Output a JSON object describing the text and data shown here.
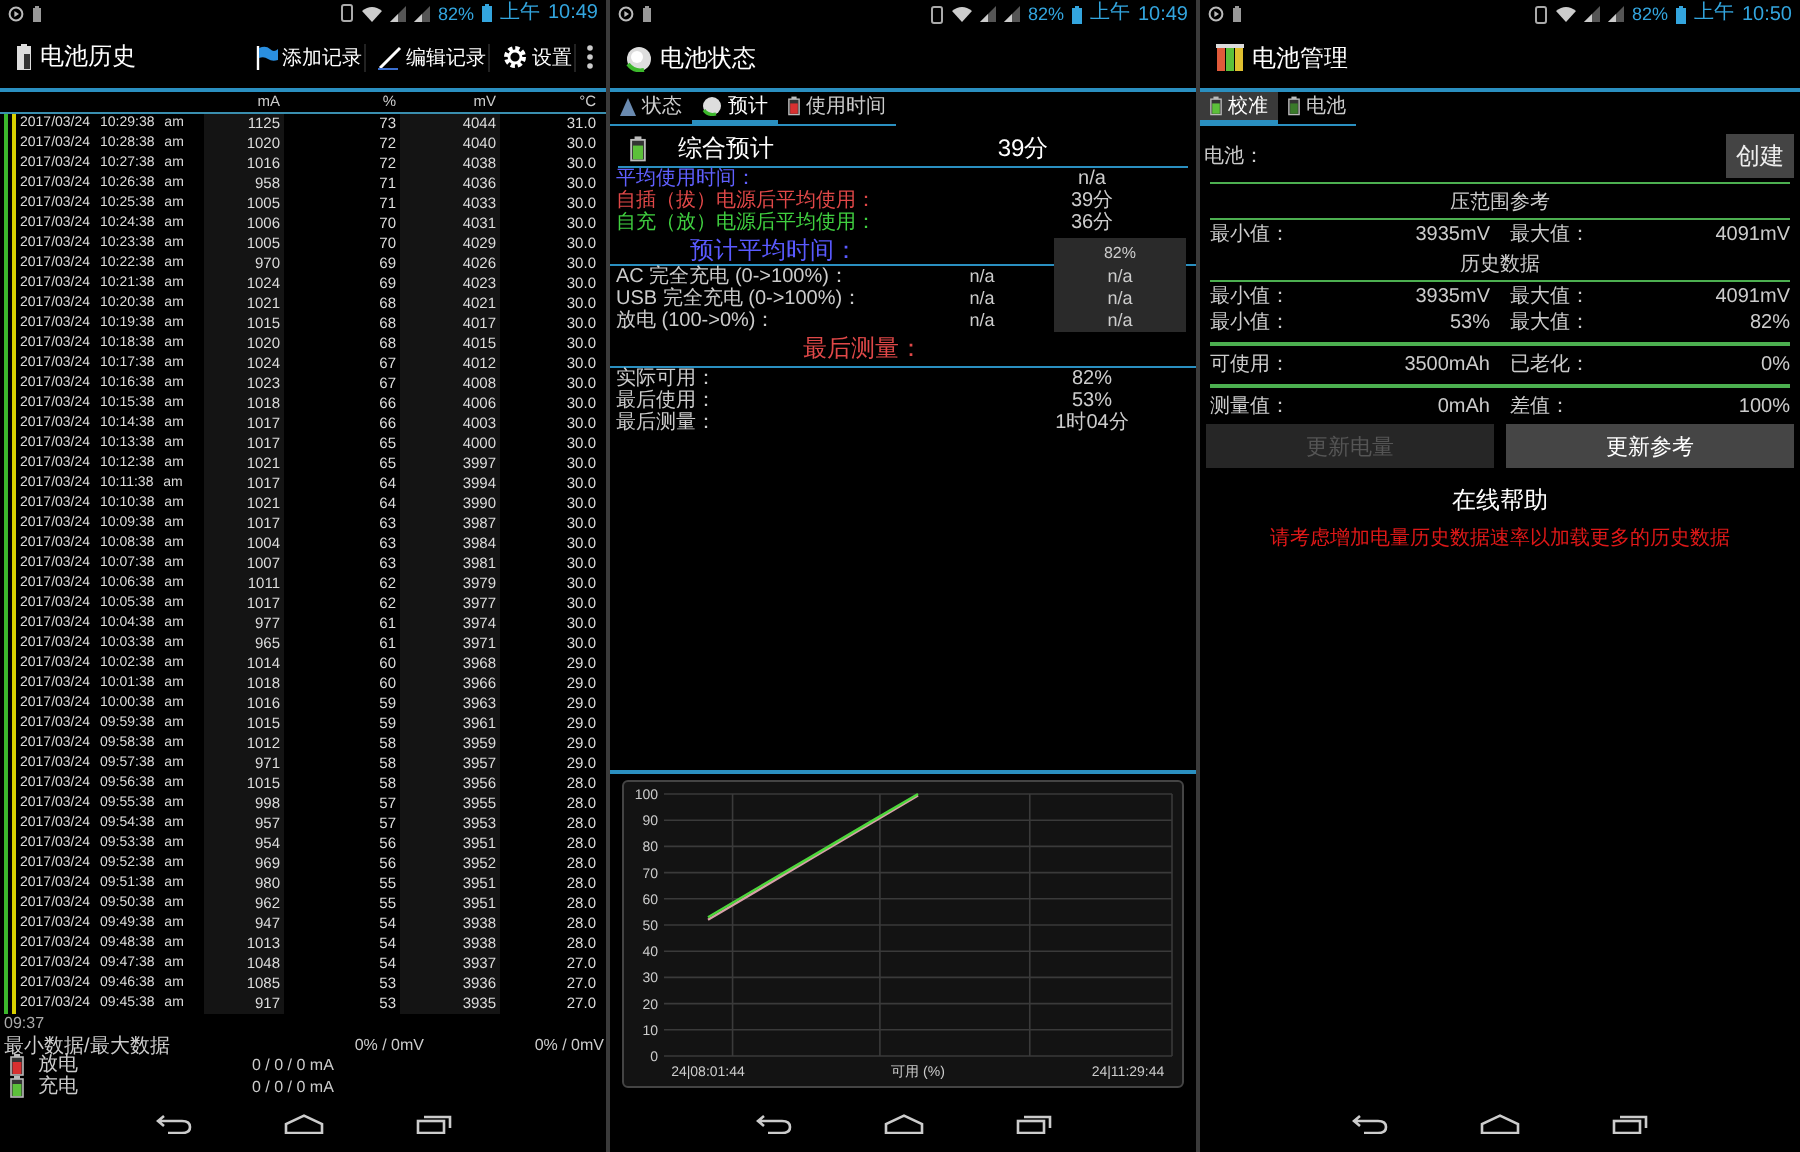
{
  "history_screen": {
    "status_bar": {
      "battery": "82%",
      "period": "上午",
      "time": "10:49"
    },
    "title": "电池历史",
    "actions": [
      {
        "label": "添加记录"
      },
      {
        "label": "编辑记录"
      },
      {
        "label": "设置"
      }
    ],
    "columns": [
      "",
      "mA",
      "%",
      "mV",
      "°C"
    ],
    "rows": [
      [
        "2017/03/24 10:29:38 am",
        "1125",
        "73",
        "4044",
        "31.0"
      ],
      [
        "2017/03/24 10:28:38 am",
        "1020",
        "72",
        "4040",
        "30.0"
      ],
      [
        "2017/03/24 10:27:38 am",
        "1016",
        "72",
        "4038",
        "30.0"
      ],
      [
        "2017/03/24 10:26:38 am",
        "958",
        "71",
        "4036",
        "30.0"
      ],
      [
        "2017/03/24 10:25:38 am",
        "1005",
        "71",
        "4033",
        "30.0"
      ],
      [
        "2017/03/24 10:24:38 am",
        "1006",
        "70",
        "4031",
        "30.0"
      ],
      [
        "2017/03/24 10:23:38 am",
        "1005",
        "70",
        "4029",
        "30.0"
      ],
      [
        "2017/03/24 10:22:38 am",
        "970",
        "69",
        "4026",
        "30.0"
      ],
      [
        "2017/03/24 10:21:38 am",
        "1024",
        "69",
        "4023",
        "30.0"
      ],
      [
        "2017/03/24 10:20:38 am",
        "1021",
        "68",
        "4021",
        "30.0"
      ],
      [
        "2017/03/24 10:19:38 am",
        "1015",
        "68",
        "4017",
        "30.0"
      ],
      [
        "2017/03/24 10:18:38 am",
        "1020",
        "68",
        "4015",
        "30.0"
      ],
      [
        "2017/03/24 10:17:38 am",
        "1024",
        "67",
        "4012",
        "30.0"
      ],
      [
        "2017/03/24 10:16:38 am",
        "1023",
        "67",
        "4008",
        "30.0"
      ],
      [
        "2017/03/24 10:15:38 am",
        "1018",
        "66",
        "4006",
        "30.0"
      ],
      [
        "2017/03/24 10:14:38 am",
        "1017",
        "66",
        "4003",
        "30.0"
      ],
      [
        "2017/03/24 10:13:38 am",
        "1017",
        "65",
        "4000",
        "30.0"
      ],
      [
        "2017/03/24 10:12:38 am",
        "1021",
        "65",
        "3997",
        "30.0"
      ],
      [
        "2017/03/24 10:11:38 am",
        "1017",
        "64",
        "3994",
        "30.0"
      ],
      [
        "2017/03/24 10:10:38 am",
        "1021",
        "64",
        "3990",
        "30.0"
      ],
      [
        "2017/03/24 10:09:38 am",
        "1017",
        "63",
        "3987",
        "30.0"
      ],
      [
        "2017/03/24 10:08:38 am",
        "1004",
        "63",
        "3984",
        "30.0"
      ],
      [
        "2017/03/24 10:07:38 am",
        "1007",
        "63",
        "3981",
        "30.0"
      ],
      [
        "2017/03/24 10:06:38 am",
        "1011",
        "62",
        "3979",
        "30.0"
      ],
      [
        "2017/03/24 10:05:38 am",
        "1017",
        "62",
        "3977",
        "30.0"
      ],
      [
        "2017/03/24 10:04:38 am",
        "977",
        "61",
        "3974",
        "30.0"
      ],
      [
        "2017/03/24 10:03:38 am",
        "965",
        "61",
        "3971",
        "30.0"
      ],
      [
        "2017/03/24 10:02:38 am",
        "1014",
        "60",
        "3968",
        "29.0"
      ],
      [
        "2017/03/24 10:01:38 am",
        "1018",
        "60",
        "3966",
        "29.0"
      ],
      [
        "2017/03/24 10:00:38 am",
        "1016",
        "59",
        "3963",
        "29.0"
      ],
      [
        "2017/03/24 09:59:38 am",
        "1015",
        "59",
        "3961",
        "29.0"
      ],
      [
        "2017/03/24 09:58:38 am",
        "1012",
        "58",
        "3959",
        "29.0"
      ],
      [
        "2017/03/24 09:57:38 am",
        "971",
        "58",
        "3957",
        "29.0"
      ],
      [
        "2017/03/24 09:56:38 am",
        "1015",
        "58",
        "3956",
        "28.0"
      ],
      [
        "2017/03/24 09:55:38 am",
        "998",
        "57",
        "3955",
        "28.0"
      ],
      [
        "2017/03/24 09:54:38 am",
        "957",
        "57",
        "3953",
        "28.0"
      ],
      [
        "2017/03/24 09:53:38 am",
        "954",
        "56",
        "3951",
        "28.0"
      ],
      [
        "2017/03/24 09:52:38 am",
        "969",
        "56",
        "3952",
        "28.0"
      ],
      [
        "2017/03/24 09:51:38 am",
        "980",
        "55",
        "3951",
        "28.0"
      ],
      [
        "2017/03/24 09:50:38 am",
        "962",
        "55",
        "3951",
        "28.0"
      ],
      [
        "2017/03/24 09:49:38 am",
        "947",
        "54",
        "3938",
        "28.0"
      ],
      [
        "2017/03/24 09:48:38 am",
        "1013",
        "54",
        "3938",
        "28.0"
      ],
      [
        "2017/03/24 09:47:38 am",
        "1048",
        "54",
        "3937",
        "27.0"
      ],
      [
        "2017/03/24 09:46:38 am",
        "1085",
        "53",
        "3936",
        "27.0"
      ],
      [
        "2017/03/24 09:45:38 am",
        "917",
        "53",
        "3935",
        "27.0"
      ]
    ],
    "footer": {
      "time": "09:37",
      "minmax_label": "最小数据/最大数据",
      "minmax_1": "0% / 0mV",
      "minmax_2": "0% / 0mV",
      "legend": [
        {
          "label": "放电",
          "value": "0 / 0 / 0 mA",
          "color": "#d83030"
        },
        {
          "label": "充电",
          "value": "0 / 0 / 0 mA",
          "color": "#5cc03a"
        }
      ]
    }
  },
  "status_screen": {
    "status_bar": {
      "battery": "82%",
      "period": "上午",
      "time": "10:49"
    },
    "title": "电池状态",
    "tabs": [
      {
        "label": "状态",
        "selected": false
      },
      {
        "label": "预计",
        "selected": true
      },
      {
        "label": "使用时间",
        "selected": false
      }
    ],
    "summary": {
      "label": "综合预计",
      "value": "39分"
    },
    "averages": [
      {
        "label": "平均使用时间：",
        "value": "n/a",
        "color": "#6060ff"
      },
      {
        "label": "自插（拔）电源后平均使用：",
        "value": "39分",
        "color": "#e04848"
      },
      {
        "label": "自充（放）电源后平均使用：",
        "value": "36分",
        "color": "#40d040"
      }
    ],
    "predicted": {
      "title": "预计平均时间：",
      "header_value": "82%",
      "rows": [
        {
          "label": "AC 完全充电 (0->100%)：",
          "col_1": "n/a",
          "col_2": "n/a"
        },
        {
          "label": "USB 完全充电 (0->100%)：",
          "col_1": "n/a",
          "col_2": "n/a"
        },
        {
          "label": "放电 (100->0%)：",
          "col_1": "n/a",
          "col_2": "n/a"
        }
      ]
    },
    "last": {
      "title": "最后测量：",
      "rows": [
        {
          "label": "实际可用：",
          "value": "82%"
        },
        {
          "label": "最后使用：",
          "value": "53%"
        },
        {
          "label": "最后测量：",
          "value": "1时04分"
        }
      ]
    },
    "chart": {
      "chart_data": {
        "type": "line",
        "xlabel": "可用 (%)",
        "grid": true,
        "categories": [
          "24|08:01:44",
          null,
          null,
          null,
          null,
          null,
          null,
          null,
          "24|11:29:44"
        ],
        "ylim": [
          0,
          100
        ],
        "yticks": [
          0,
          10,
          20,
          30,
          40,
          50,
          60,
          70,
          80,
          90,
          100
        ],
        "series": [
          {
            "color": "#d8a0a8",
            "values": [
              52,
              63.9,
              75.8,
              87.6,
              99.5,
              null,
              null,
              null,
              null
            ]
          },
          {
            "color": "#4cd63a",
            "values": [
              53,
              64.8,
              76.5,
              88.3,
              100,
              null,
              null,
              null,
              null
            ]
          }
        ]
      }
    }
  },
  "manage_screen": {
    "status_bar": {
      "battery": "82%",
      "period": "上午",
      "time": "10:50"
    },
    "title": "电池管理",
    "tabs": [
      {
        "label": "校准",
        "selected": true
      },
      {
        "label": "电池",
        "selected": false
      }
    ],
    "battery_label": "电池：",
    "create_button": "创建",
    "sections": [
      {
        "title": "压范围参考",
        "rows": [
          {
            "label_1": "最小值：",
            "value_1": "3935mV",
            "label_2": "最大值：",
            "value_2": "4091mV"
          }
        ]
      },
      {
        "title": "历史数据",
        "rows": [
          {
            "label_1": "最小值：",
            "value_1": "3935mV",
            "label_2": "最大值：",
            "value_2": "4091mV"
          },
          {
            "label_1": "最小值：",
            "value_1": "53%",
            "label_2": "最大值：",
            "value_2": "82%"
          }
        ]
      }
    ],
    "capacity": {
      "label_1": "可使用：",
      "value_1": "3500mAh",
      "label_2": "已老化：",
      "value_2": "0%"
    },
    "measurement": {
      "label_1": "测量值：",
      "value_1": "0mAh",
      "label_2": "差值：",
      "value_2": "100%"
    },
    "buttons": [
      {
        "label": "更新电量",
        "disabled": true
      },
      {
        "label": "更新参考",
        "disabled": false
      }
    ],
    "help_title": "在线帮助",
    "help_note": "请考虑增加电量历史数据速率以加载更多的历史数据"
  }
}
